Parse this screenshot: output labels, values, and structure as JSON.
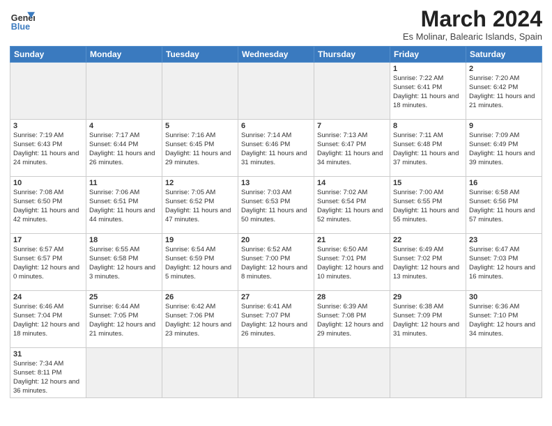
{
  "header": {
    "logo_line1": "General",
    "logo_line2": "Blue",
    "month": "March 2024",
    "location": "Es Molinar, Balearic Islands, Spain"
  },
  "days_of_week": [
    "Sunday",
    "Monday",
    "Tuesday",
    "Wednesday",
    "Thursday",
    "Friday",
    "Saturday"
  ],
  "weeks": [
    [
      {
        "num": "",
        "info": "",
        "empty": true
      },
      {
        "num": "",
        "info": "",
        "empty": true
      },
      {
        "num": "",
        "info": "",
        "empty": true
      },
      {
        "num": "",
        "info": "",
        "empty": true
      },
      {
        "num": "",
        "info": "",
        "empty": true
      },
      {
        "num": "1",
        "info": "Sunrise: 7:22 AM\nSunset: 6:41 PM\nDaylight: 11 hours and 18 minutes.",
        "empty": false
      },
      {
        "num": "2",
        "info": "Sunrise: 7:20 AM\nSunset: 6:42 PM\nDaylight: 11 hours and 21 minutes.",
        "empty": false
      }
    ],
    [
      {
        "num": "3",
        "info": "Sunrise: 7:19 AM\nSunset: 6:43 PM\nDaylight: 11 hours and 24 minutes.",
        "empty": false
      },
      {
        "num": "4",
        "info": "Sunrise: 7:17 AM\nSunset: 6:44 PM\nDaylight: 11 hours and 26 minutes.",
        "empty": false
      },
      {
        "num": "5",
        "info": "Sunrise: 7:16 AM\nSunset: 6:45 PM\nDaylight: 11 hours and 29 minutes.",
        "empty": false
      },
      {
        "num": "6",
        "info": "Sunrise: 7:14 AM\nSunset: 6:46 PM\nDaylight: 11 hours and 31 minutes.",
        "empty": false
      },
      {
        "num": "7",
        "info": "Sunrise: 7:13 AM\nSunset: 6:47 PM\nDaylight: 11 hours and 34 minutes.",
        "empty": false
      },
      {
        "num": "8",
        "info": "Sunrise: 7:11 AM\nSunset: 6:48 PM\nDaylight: 11 hours and 37 minutes.",
        "empty": false
      },
      {
        "num": "9",
        "info": "Sunrise: 7:09 AM\nSunset: 6:49 PM\nDaylight: 11 hours and 39 minutes.",
        "empty": false
      }
    ],
    [
      {
        "num": "10",
        "info": "Sunrise: 7:08 AM\nSunset: 6:50 PM\nDaylight: 11 hours and 42 minutes.",
        "empty": false
      },
      {
        "num": "11",
        "info": "Sunrise: 7:06 AM\nSunset: 6:51 PM\nDaylight: 11 hours and 44 minutes.",
        "empty": false
      },
      {
        "num": "12",
        "info": "Sunrise: 7:05 AM\nSunset: 6:52 PM\nDaylight: 11 hours and 47 minutes.",
        "empty": false
      },
      {
        "num": "13",
        "info": "Sunrise: 7:03 AM\nSunset: 6:53 PM\nDaylight: 11 hours and 50 minutes.",
        "empty": false
      },
      {
        "num": "14",
        "info": "Sunrise: 7:02 AM\nSunset: 6:54 PM\nDaylight: 11 hours and 52 minutes.",
        "empty": false
      },
      {
        "num": "15",
        "info": "Sunrise: 7:00 AM\nSunset: 6:55 PM\nDaylight: 11 hours and 55 minutes.",
        "empty": false
      },
      {
        "num": "16",
        "info": "Sunrise: 6:58 AM\nSunset: 6:56 PM\nDaylight: 11 hours and 57 minutes.",
        "empty": false
      }
    ],
    [
      {
        "num": "17",
        "info": "Sunrise: 6:57 AM\nSunset: 6:57 PM\nDaylight: 12 hours and 0 minutes.",
        "empty": false
      },
      {
        "num": "18",
        "info": "Sunrise: 6:55 AM\nSunset: 6:58 PM\nDaylight: 12 hours and 3 minutes.",
        "empty": false
      },
      {
        "num": "19",
        "info": "Sunrise: 6:54 AM\nSunset: 6:59 PM\nDaylight: 12 hours and 5 minutes.",
        "empty": false
      },
      {
        "num": "20",
        "info": "Sunrise: 6:52 AM\nSunset: 7:00 PM\nDaylight: 12 hours and 8 minutes.",
        "empty": false
      },
      {
        "num": "21",
        "info": "Sunrise: 6:50 AM\nSunset: 7:01 PM\nDaylight: 12 hours and 10 minutes.",
        "empty": false
      },
      {
        "num": "22",
        "info": "Sunrise: 6:49 AM\nSunset: 7:02 PM\nDaylight: 12 hours and 13 minutes.",
        "empty": false
      },
      {
        "num": "23",
        "info": "Sunrise: 6:47 AM\nSunset: 7:03 PM\nDaylight: 12 hours and 16 minutes.",
        "empty": false
      }
    ],
    [
      {
        "num": "24",
        "info": "Sunrise: 6:46 AM\nSunset: 7:04 PM\nDaylight: 12 hours and 18 minutes.",
        "empty": false
      },
      {
        "num": "25",
        "info": "Sunrise: 6:44 AM\nSunset: 7:05 PM\nDaylight: 12 hours and 21 minutes.",
        "empty": false
      },
      {
        "num": "26",
        "info": "Sunrise: 6:42 AM\nSunset: 7:06 PM\nDaylight: 12 hours and 23 minutes.",
        "empty": false
      },
      {
        "num": "27",
        "info": "Sunrise: 6:41 AM\nSunset: 7:07 PM\nDaylight: 12 hours and 26 minutes.",
        "empty": false
      },
      {
        "num": "28",
        "info": "Sunrise: 6:39 AM\nSunset: 7:08 PM\nDaylight: 12 hours and 29 minutes.",
        "empty": false
      },
      {
        "num": "29",
        "info": "Sunrise: 6:38 AM\nSunset: 7:09 PM\nDaylight: 12 hours and 31 minutes.",
        "empty": false
      },
      {
        "num": "30",
        "info": "Sunrise: 6:36 AM\nSunset: 7:10 PM\nDaylight: 12 hours and 34 minutes.",
        "empty": false
      }
    ],
    [
      {
        "num": "31",
        "info": "Sunrise: 7:34 AM\nSunset: 8:11 PM\nDaylight: 12 hours and 36 minutes.",
        "empty": false
      },
      {
        "num": "",
        "info": "",
        "empty": true
      },
      {
        "num": "",
        "info": "",
        "empty": true
      },
      {
        "num": "",
        "info": "",
        "empty": true
      },
      {
        "num": "",
        "info": "",
        "empty": true
      },
      {
        "num": "",
        "info": "",
        "empty": true
      },
      {
        "num": "",
        "info": "",
        "empty": true
      }
    ]
  ]
}
